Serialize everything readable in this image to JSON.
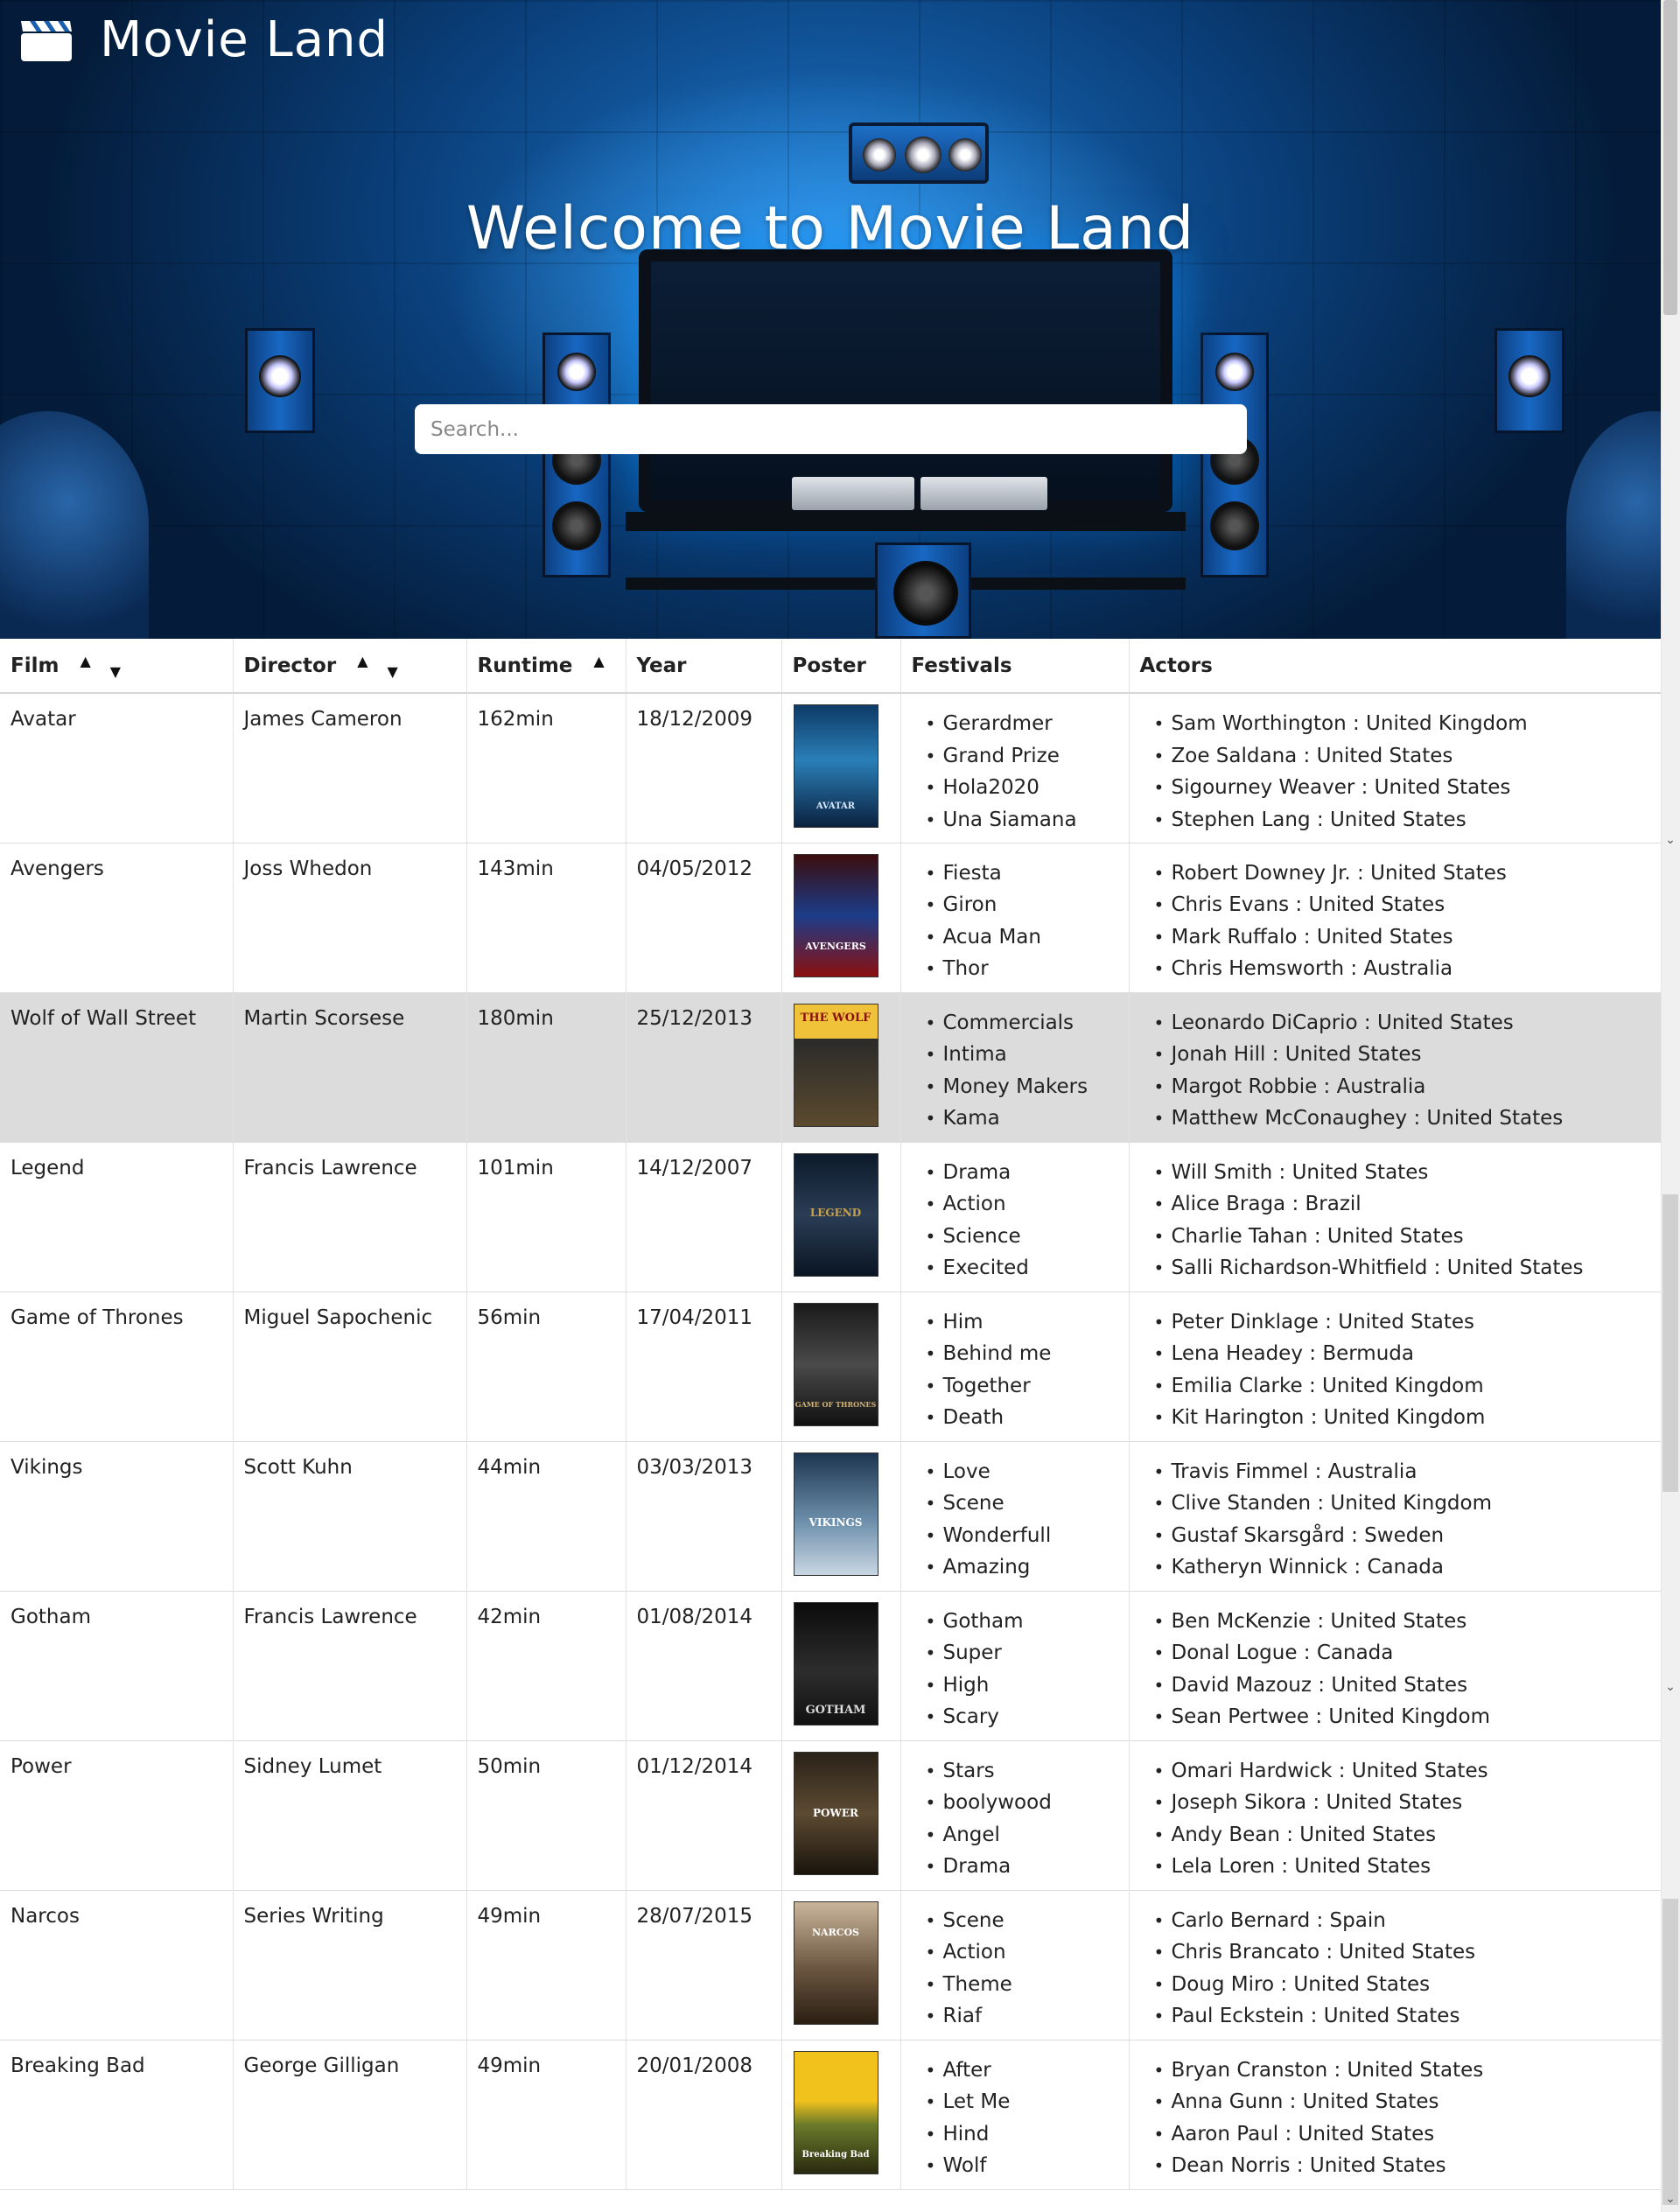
{
  "brand": {
    "name": "Movie Land",
    "icon": "clapperboard-icon"
  },
  "hero": {
    "title": "Welcome to Movie Land"
  },
  "search": {
    "placeholder": "Search..."
  },
  "table": {
    "columns": [
      {
        "label": "Film",
        "sort": "both"
      },
      {
        "label": "Director",
        "sort": "both"
      },
      {
        "label": "Runtime",
        "sort": "up"
      },
      {
        "label": "Year",
        "sort": "none"
      },
      {
        "label": "Poster",
        "sort": "none"
      },
      {
        "label": "Festivals",
        "sort": "none"
      },
      {
        "label": "Actors",
        "sort": "none"
      }
    ],
    "rows": [
      {
        "film": "Avatar",
        "director": "James Cameron",
        "runtime": "162min",
        "year": "18/12/2009",
        "poster_text": "AVATAR",
        "festivals": [
          "Gerardmer",
          "Grand Prize",
          "Hola2020",
          "Una Siamana"
        ],
        "actors": [
          "Sam Worthington : United Kingdom",
          "Zoe Saldana : United States",
          "Sigourney Weaver : United States",
          "Stephen Lang : United States"
        ]
      },
      {
        "film": "Avengers",
        "director": "Joss Whedon",
        "runtime": "143min",
        "year": "04/05/2012",
        "poster_text": "AVENGERS",
        "festivals": [
          "Fiesta",
          "Giron",
          "Acua Man",
          "Thor"
        ],
        "actors": [
          "Robert Downey Jr. : United States",
          "Chris Evans : United States",
          "Mark Ruffalo : United States",
          "Chris Hemsworth : Australia"
        ]
      },
      {
        "film": "Wolf of Wall Street",
        "director": "Martin Scorsese",
        "runtime": "180min",
        "year": "25/12/2013",
        "poster_text": "THE WOLF",
        "festivals": [
          "Commercials",
          "Intima",
          "Money Makers",
          "Kama"
        ],
        "actors": [
          "Leonardo DiCaprio : United States",
          "Jonah Hill : United States",
          "Margot Robbie : Australia",
          "Matthew McConaughey : United States"
        ]
      },
      {
        "film": "Legend",
        "director": "Francis Lawrence",
        "runtime": "101min",
        "year": "14/12/2007",
        "poster_text": "LEGEND",
        "festivals": [
          "Drama",
          "Action",
          "Science",
          "Execited"
        ],
        "actors": [
          "Will Smith : United States",
          "Alice Braga : Brazil",
          "Charlie Tahan : United States",
          "Salli Richardson-Whitfield : United States"
        ]
      },
      {
        "film": "Game of Thrones",
        "director": "Miguel Sapochenic",
        "runtime": "56min",
        "year": "17/04/2011",
        "poster_text": "GAME OF THRONES",
        "festivals": [
          "Him",
          "Behind me",
          "Together",
          "Death"
        ],
        "actors": [
          "Peter Dinklage : United States",
          "Lena Headey : Bermuda",
          "Emilia Clarke : United Kingdom",
          "Kit Harington : United Kingdom"
        ]
      },
      {
        "film": "Vikings",
        "director": "Scott Kuhn",
        "runtime": "44min",
        "year": "03/03/2013",
        "poster_text": "VIKINGS",
        "festivals": [
          "Love",
          "Scene",
          "Wonderfull",
          "Amazing"
        ],
        "actors": [
          "Travis Fimmel : Australia",
          "Clive Standen : United Kingdom",
          "Gustaf Skarsgård : Sweden",
          "Katheryn Winnick : Canada"
        ]
      },
      {
        "film": "Gotham",
        "director": "Francis Lawrence",
        "runtime": "42min",
        "year": "01/08/2014",
        "poster_text": "GOTHAM",
        "festivals": [
          "Gotham",
          "Super",
          "High",
          "Scary"
        ],
        "actors": [
          "Ben McKenzie : United States",
          "Donal Logue : Canada",
          "David Mazouz : United States",
          "Sean Pertwee : United Kingdom"
        ]
      },
      {
        "film": "Power",
        "director": "Sidney Lumet",
        "runtime": "50min",
        "year": "01/12/2014",
        "poster_text": "POWER",
        "festivals": [
          "Stars",
          "boolywood",
          "Angel",
          "Drama"
        ],
        "actors": [
          "Omari Hardwick : United States",
          "Joseph Sikora : United States",
          "Andy Bean : United States",
          "Lela Loren : United States"
        ]
      },
      {
        "film": "Narcos",
        "director": "Series Writing",
        "runtime": "49min",
        "year": "28/07/2015",
        "poster_text": "NARCOS",
        "festivals": [
          "Scene",
          "Action",
          "Theme",
          "Riaf"
        ],
        "actors": [
          "Carlo Bernard : Spain",
          "Chris Brancato : United States",
          "Doug Miro : United States",
          "Paul Eckstein : United States"
        ]
      },
      {
        "film": "Breaking Bad",
        "director": "George Gilligan",
        "runtime": "49min",
        "year": "20/01/2008",
        "poster_text": "Breaking Bad",
        "festivals": [
          "After",
          "Let Me",
          "Hind",
          "Wolf"
        ],
        "actors": [
          "Bryan Cranston : United States",
          "Anna Gunn : United States",
          "Aaron Paul : United States",
          "Dean Norris : United States"
        ]
      }
    ]
  },
  "colors": {
    "hero_blue": "#1b72c4",
    "highlight_row": "#dcdcdc",
    "header_text": "#222222"
  }
}
